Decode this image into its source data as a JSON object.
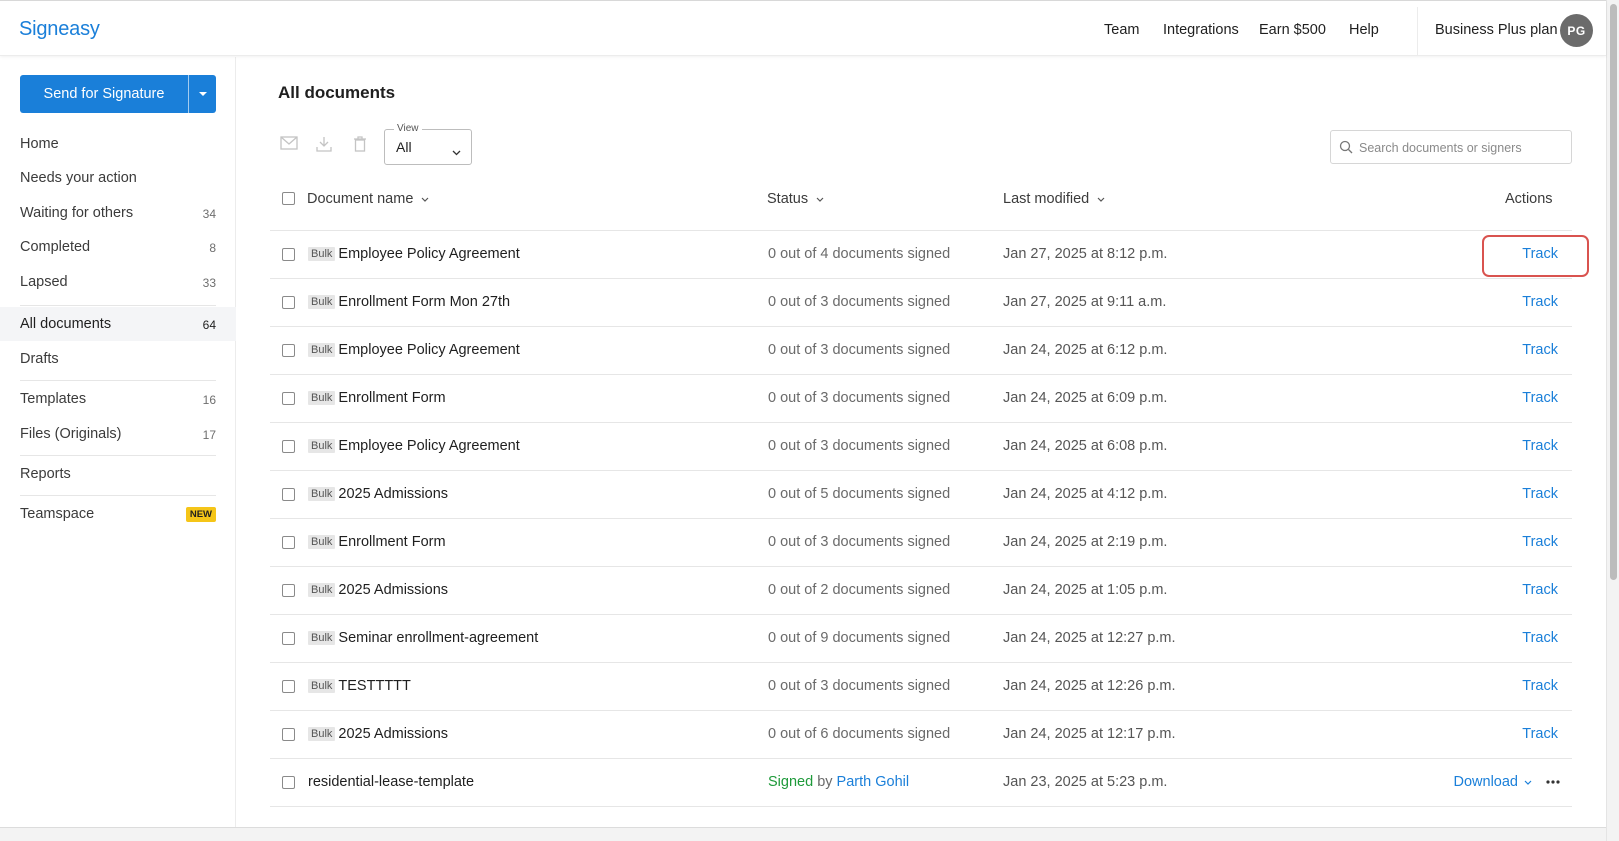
{
  "app": {
    "logo": "Signeasy"
  },
  "header": {
    "nav": [
      "Team",
      "Integrations",
      "Earn $500",
      "Help"
    ],
    "plan": "Business Plus plan",
    "avatar_initials": "PG"
  },
  "sidebar": {
    "send_button": "Send for Signature",
    "items": [
      {
        "label": "Home",
        "count": ""
      },
      {
        "label": "Needs your action",
        "count": ""
      },
      {
        "label": "Waiting for others",
        "count": "34"
      },
      {
        "label": "Completed",
        "count": "8"
      },
      {
        "label": "Lapsed",
        "count": "33"
      },
      {
        "label": "All documents",
        "count": "64",
        "active": true
      },
      {
        "label": "Drafts",
        "count": ""
      },
      {
        "label": "Templates",
        "count": "16"
      },
      {
        "label": "Files (Originals)",
        "count": "17"
      },
      {
        "label": "Reports",
        "count": ""
      },
      {
        "label": "Teamspace",
        "badge": "NEW"
      }
    ]
  },
  "main": {
    "title": "All documents",
    "view": {
      "legend": "View",
      "value": "All"
    },
    "search": {
      "placeholder": "Search documents or signers"
    },
    "columns": [
      "Document name",
      "Status",
      "Last modified",
      "Actions"
    ],
    "bulk_tag": "Bulk",
    "rows": [
      {
        "bulk": true,
        "name": "Employee Policy Agreement",
        "status": "0 out of 4 documents signed",
        "modified": "Jan 27, 2025 at 8:12 p.m.",
        "action": "Track"
      },
      {
        "bulk": true,
        "name": "Enrollment Form Mon 27th",
        "status": "0 out of 3 documents signed",
        "modified": "Jan 27, 2025 at 9:11 a.m.",
        "action": "Track"
      },
      {
        "bulk": true,
        "name": "Employee Policy Agreement",
        "status": "0 out of 3 documents signed",
        "modified": "Jan 24, 2025 at 6:12 p.m.",
        "action": "Track"
      },
      {
        "bulk": true,
        "name": "Enrollment Form",
        "status": "0 out of 3 documents signed",
        "modified": "Jan 24, 2025 at 6:09 p.m.",
        "action": "Track"
      },
      {
        "bulk": true,
        "name": "Employee Policy Agreement",
        "status": "0 out of 3 documents signed",
        "modified": "Jan 24, 2025 at 6:08 p.m.",
        "action": "Track"
      },
      {
        "bulk": true,
        "name": "2025 Admissions",
        "status": "0 out of 5 documents signed",
        "modified": "Jan 24, 2025 at 4:12 p.m.",
        "action": "Track"
      },
      {
        "bulk": true,
        "name": "Enrollment Form",
        "status": "0 out of 3 documents signed",
        "modified": "Jan 24, 2025 at 2:19 p.m.",
        "action": "Track"
      },
      {
        "bulk": true,
        "name": "2025 Admissions",
        "status": "0 out of 2 documents signed",
        "modified": "Jan 24, 2025 at 1:05 p.m.",
        "action": "Track"
      },
      {
        "bulk": true,
        "name": "Seminar enrollment-agreement",
        "status": "0 out of 9 documents signed",
        "modified": "Jan 24, 2025 at 12:27 p.m.",
        "action": "Track"
      },
      {
        "bulk": true,
        "name": "TESTTTTT",
        "status": "0 out of 3 documents signed",
        "modified": "Jan 24, 2025 at 12:26 p.m.",
        "action": "Track"
      },
      {
        "bulk": true,
        "name": "2025 Admissions",
        "status": "0 out of 6 documents signed",
        "modified": "Jan 24, 2025 at 12:17 p.m.",
        "action": "Track"
      }
    ],
    "last_row": {
      "name": "residential-lease-template",
      "status_word": "Signed",
      "by_word": "by",
      "signer": "Parth Gohil",
      "modified": "Jan 23, 2025 at 5:23 p.m.",
      "action": "Download"
    }
  },
  "colors": {
    "brand": "#1a7fd9",
    "signed": "#1e9a3a",
    "highlight": "#d9534f",
    "new_badge": "#f5c518"
  }
}
